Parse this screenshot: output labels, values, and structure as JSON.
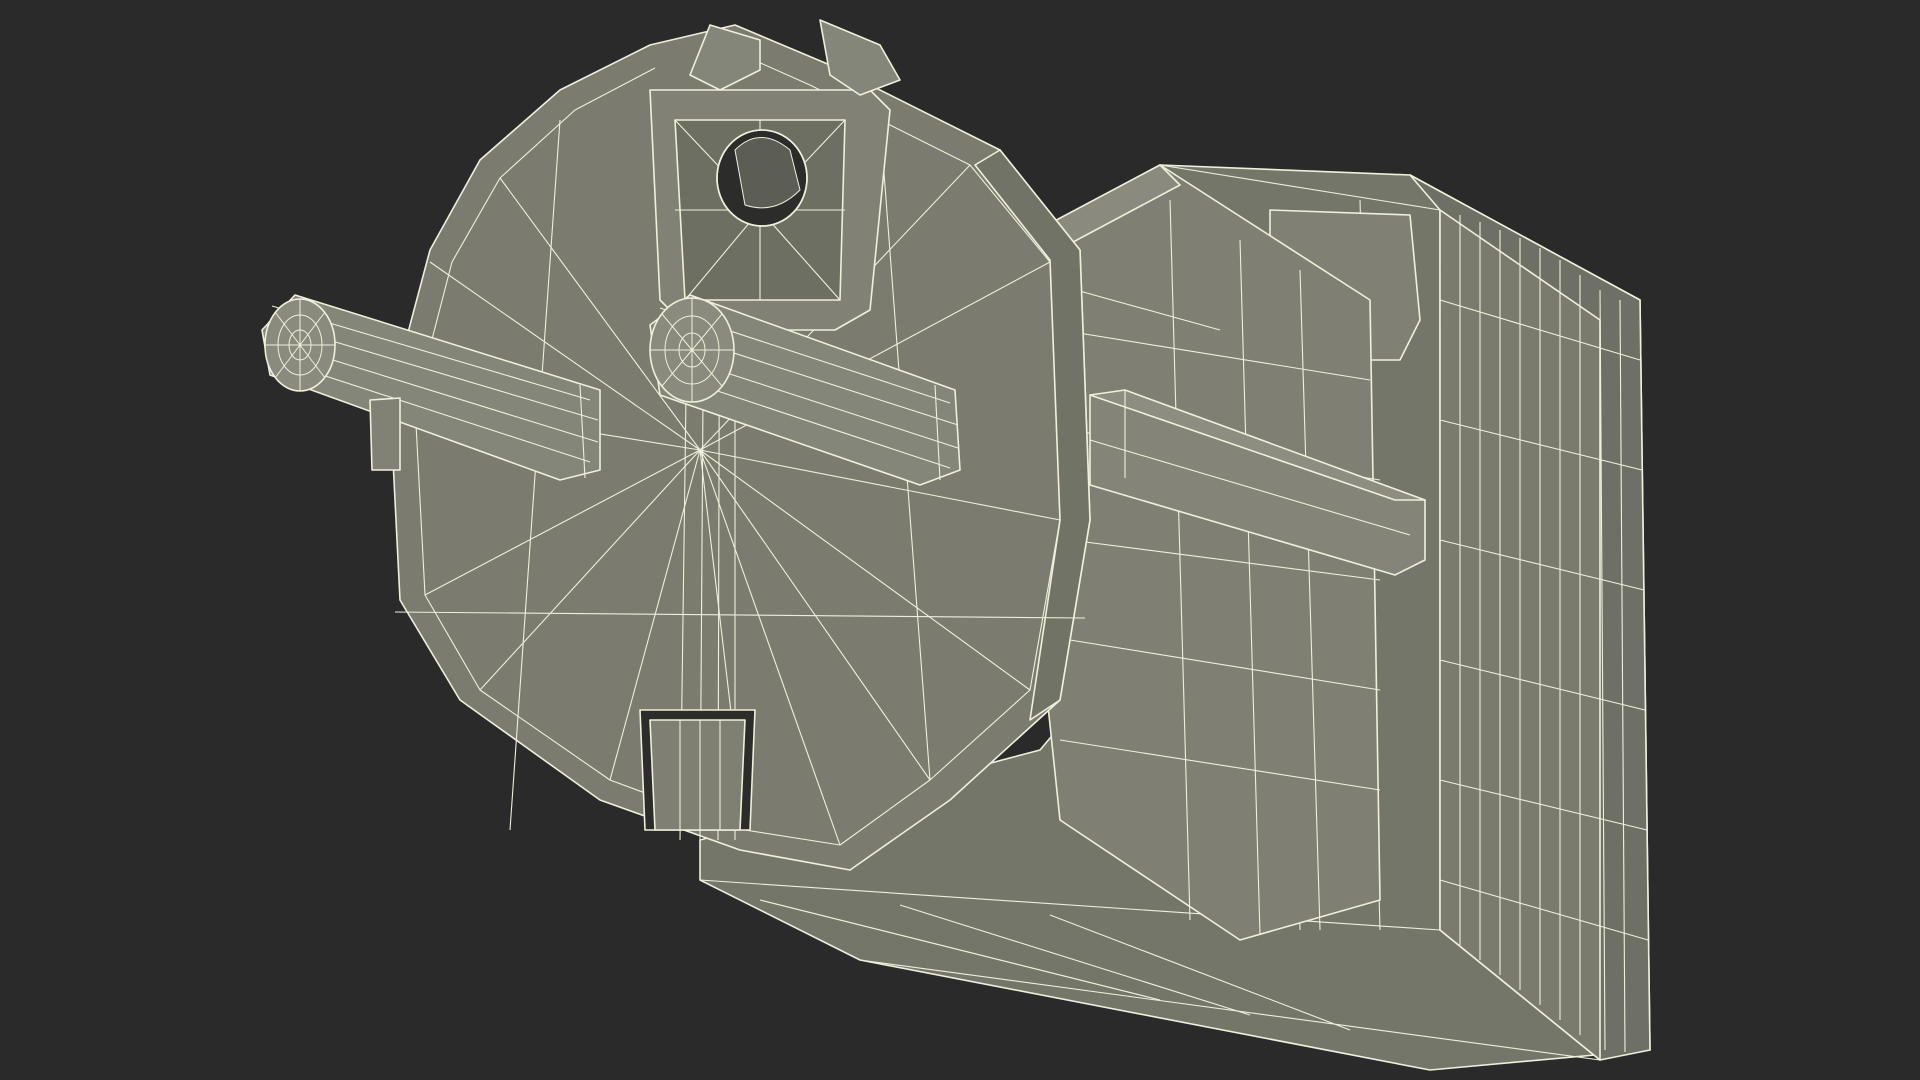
{
  "scene": {
    "subject": "wireframe-render",
    "background_color": "#2a2a2a",
    "surface_color": "#7b7c6f",
    "surface_shadow_color": "#66675c",
    "wire_color": "#efefdc"
  }
}
